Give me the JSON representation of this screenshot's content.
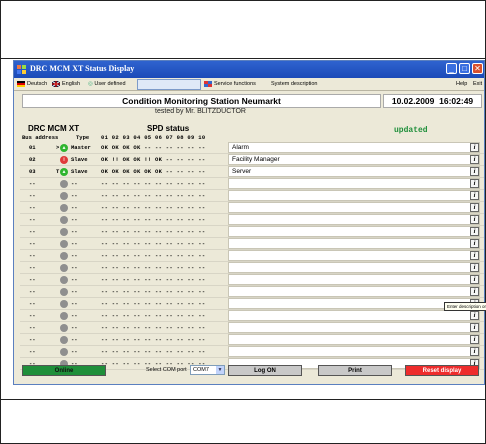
{
  "window": {
    "title": "DRC MCM XT Status Display"
  },
  "menu": {
    "lang_de": "Deutsch",
    "lang_en": "English",
    "user_defined": "User defined",
    "service": "Service functions",
    "system": "System description",
    "help": "Help",
    "exit": "Exit"
  },
  "header": {
    "station": "Condition Monitoring Station Neumarkt",
    "tested_by": "tested by Mr. BLITZDUCTOR",
    "date": "10.02.2009",
    "time": "16:02:49",
    "device": "DRC MCM XT",
    "section": "SPD status",
    "status": "updated",
    "col_bus": "Bus address",
    "col_type": "Type",
    "col_spd": "01 02 03 04 05 06 07 08 09 10"
  },
  "rows": [
    {
      "addr": "01",
      "arrow": ">",
      "status": "green",
      "type": "Master",
      "spd": "OK OK OK OK -- -- -- -- -- --",
      "desc": "Alarm"
    },
    {
      "addr": "02",
      "arrow": "",
      "status": "red",
      "type": "Slave",
      "spd": "OK !! OK OK !! OK -- -- -- --",
      "desc": "Facility Manager"
    },
    {
      "addr": "03",
      "arrow": "T",
      "status": "green",
      "type": "Slave",
      "spd": "OK OK OK OK OK OK -- -- -- --",
      "desc": "Server"
    },
    {
      "addr": "--",
      "arrow": "",
      "status": "gray",
      "type": "--",
      "spd": "-- -- -- -- -- -- -- -- -- --",
      "desc": ""
    },
    {
      "addr": "--",
      "arrow": "",
      "status": "gray",
      "type": "--",
      "spd": "-- -- -- -- -- -- -- -- -- --",
      "desc": ""
    },
    {
      "addr": "--",
      "arrow": "",
      "status": "gray",
      "type": "--",
      "spd": "-- -- -- -- -- -- -- -- -- --",
      "desc": ""
    },
    {
      "addr": "--",
      "arrow": "",
      "status": "gray",
      "type": "--",
      "spd": "-- -- -- -- -- -- -- -- -- --",
      "desc": ""
    },
    {
      "addr": "--",
      "arrow": "",
      "status": "gray",
      "type": "--",
      "spd": "-- -- -- -- -- -- -- -- -- --",
      "desc": ""
    },
    {
      "addr": "--",
      "arrow": "",
      "status": "gray",
      "type": "--",
      "spd": "-- -- -- -- -- -- -- -- -- --",
      "desc": ""
    },
    {
      "addr": "--",
      "arrow": "",
      "status": "gray",
      "type": "--",
      "spd": "-- -- -- -- -- -- -- -- -- --",
      "desc": ""
    },
    {
      "addr": "--",
      "arrow": "",
      "status": "gray",
      "type": "--",
      "spd": "-- -- -- -- -- -- -- -- -- --",
      "desc": ""
    },
    {
      "addr": "--",
      "arrow": "",
      "status": "gray",
      "type": "--",
      "spd": "-- -- -- -- -- -- -- -- -- --",
      "desc": ""
    },
    {
      "addr": "--",
      "arrow": "",
      "status": "gray",
      "type": "--",
      "spd": "-- -- -- -- -- -- -- -- -- --",
      "desc": ""
    },
    {
      "addr": "--",
      "arrow": "",
      "status": "gray",
      "type": "--",
      "spd": "-- -- -- -- -- -- -- -- -- --",
      "desc": ""
    },
    {
      "addr": "--",
      "arrow": "",
      "status": "gray",
      "type": "--",
      "spd": "-- -- -- -- -- -- -- -- -- --",
      "desc": ""
    },
    {
      "addr": "--",
      "arrow": "",
      "status": "gray",
      "type": "--",
      "spd": "-- -- -- -- -- -- -- -- -- --",
      "desc": ""
    },
    {
      "addr": "--",
      "arrow": "",
      "status": "gray",
      "type": "--",
      "spd": "-- -- -- -- -- -- -- -- -- --",
      "desc": ""
    },
    {
      "addr": "--",
      "arrow": "",
      "status": "gray",
      "type": "--",
      "spd": "-- -- -- -- -- -- -- -- -- --",
      "desc": ""
    },
    {
      "addr": "--",
      "arrow": "",
      "status": "gray",
      "type": "--",
      "spd": "-- -- -- -- -- -- -- -- -- --",
      "desc": ""
    }
  ],
  "info_label": "i",
  "tooltip": "Enter description or comment",
  "footer": {
    "online": "Online",
    "com_label": "Select COM port",
    "com_value": "COM7",
    "log_on": "Log ON",
    "print": "Print",
    "reset": "Reset display"
  },
  "colors": {
    "green": "#2fb52f",
    "red": "#e03a3a",
    "gray": "#8f8f8f",
    "online_bg": "#1f8f3a",
    "reset_bg": "#ee2c2c",
    "status_text": "#1f8f3a"
  }
}
